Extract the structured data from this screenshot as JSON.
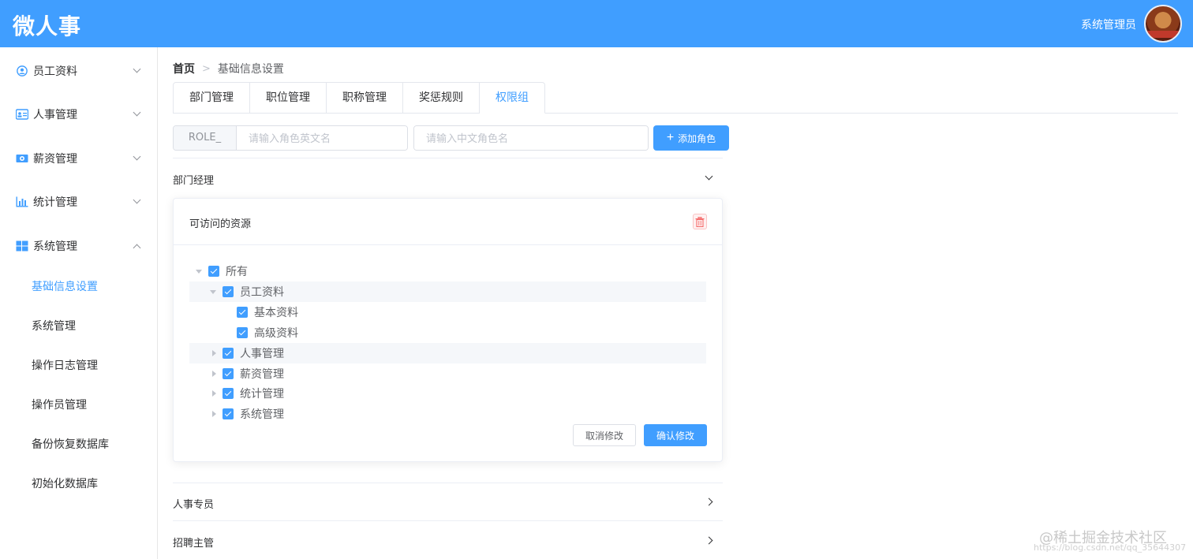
{
  "header": {
    "logo": "微人事",
    "user_name": "系统管理员"
  },
  "sidebar": {
    "menus": [
      {
        "label": "员工资料",
        "icon": "user-circle-icon",
        "expanded": false
      },
      {
        "label": "人事管理",
        "icon": "id-card-icon",
        "expanded": false
      },
      {
        "label": "薪资管理",
        "icon": "money-icon",
        "expanded": false
      },
      {
        "label": "统计管理",
        "icon": "bar-chart-icon",
        "expanded": false
      },
      {
        "label": "系统管理",
        "icon": "windows-icon",
        "expanded": true
      }
    ],
    "sub_items": [
      {
        "label": "基础信息设置",
        "active": true
      },
      {
        "label": "系统管理",
        "active": false
      },
      {
        "label": "操作日志管理",
        "active": false
      },
      {
        "label": "操作员管理",
        "active": false
      },
      {
        "label": "备份恢复数据库",
        "active": false
      },
      {
        "label": "初始化数据库",
        "active": false
      }
    ]
  },
  "breadcrumb": {
    "home": "首页",
    "separator": ">",
    "current": "基础信息设置"
  },
  "tabs": [
    {
      "label": "部门管理",
      "active": false
    },
    {
      "label": "职位管理",
      "active": false
    },
    {
      "label": "职称管理",
      "active": false
    },
    {
      "label": "奖惩规则",
      "active": false
    },
    {
      "label": "权限组",
      "active": true
    }
  ],
  "role_form": {
    "prefix": "ROLE_",
    "en_placeholder": "请输入角色英文名",
    "en_value": "",
    "zh_placeholder": "请输入中文角色名",
    "zh_value": "",
    "add_label": "添加角色"
  },
  "roles": [
    {
      "name": "部门经理",
      "expanded": true
    },
    {
      "name": "人事专员",
      "expanded": false
    },
    {
      "name": "招聘主管",
      "expanded": false
    }
  ],
  "card": {
    "title": "可访问的资源",
    "cancel_label": "取消修改",
    "confirm_label": "确认修改"
  },
  "tree": [
    {
      "label": "所有",
      "checked": true,
      "expanded": true
    },
    {
      "label": "员工资料",
      "checked": true,
      "expanded": true
    },
    {
      "label": "基本资料",
      "checked": true
    },
    {
      "label": "高级资料",
      "checked": true
    },
    {
      "label": "人事管理",
      "checked": true,
      "expanded": false
    },
    {
      "label": "薪资管理",
      "checked": true,
      "expanded": false
    },
    {
      "label": "统计管理",
      "checked": true,
      "expanded": false
    },
    {
      "label": "系统管理",
      "checked": true,
      "expanded": false
    }
  ],
  "colors": {
    "primary": "#409eff",
    "danger": "#f56c6c"
  },
  "watermark": {
    "main": "@稀土掘金技术社区",
    "sub": "https://blog.csdn.net/qq_35644307"
  }
}
